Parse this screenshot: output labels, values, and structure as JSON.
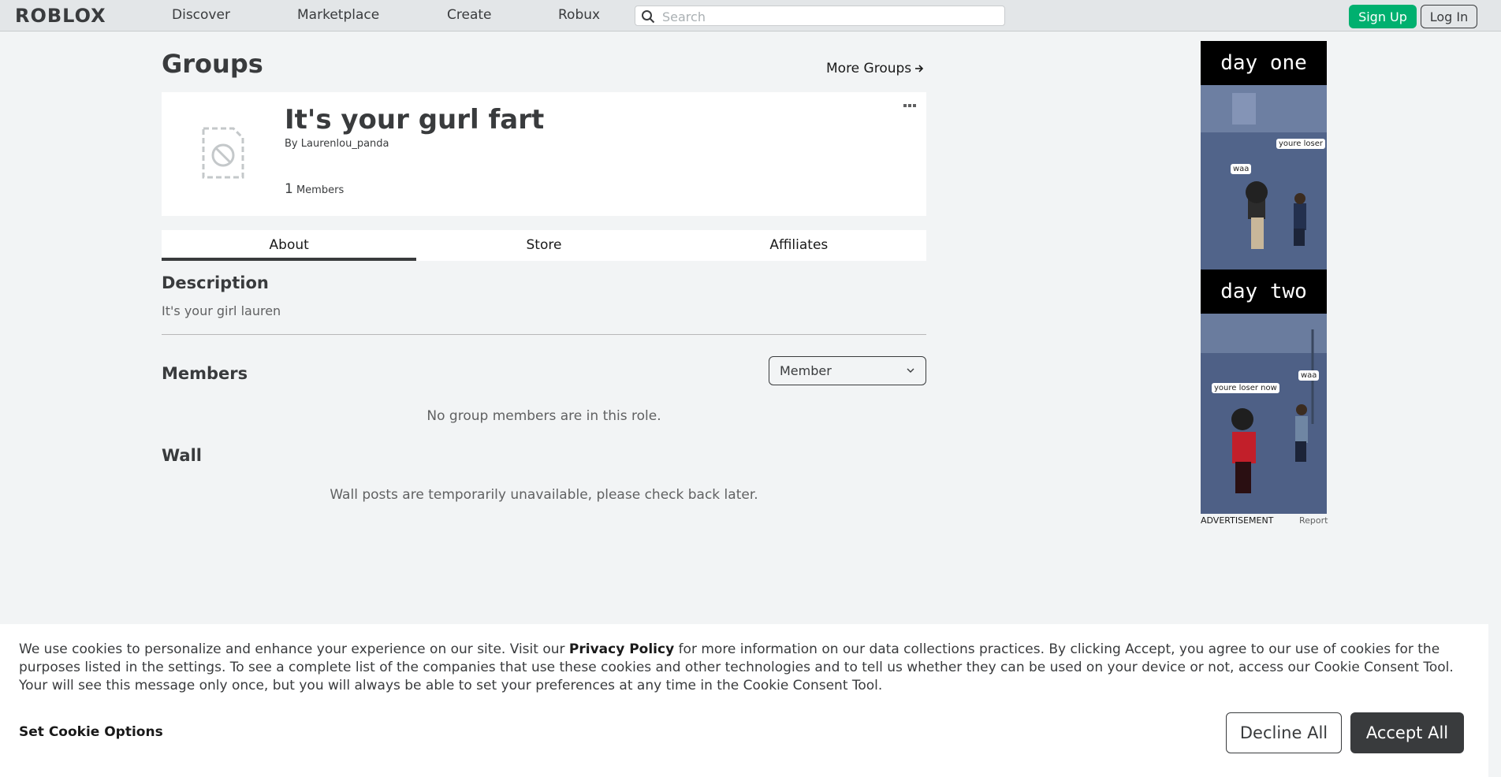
{
  "nav": {
    "logo": "ROBLOX",
    "links": [
      "Discover",
      "Marketplace",
      "Create",
      "Robux"
    ],
    "search_placeholder": "Search",
    "signup_label": "Sign Up",
    "login_label": "Log In"
  },
  "page": {
    "title": "Groups",
    "more_groups": "More Groups"
  },
  "group": {
    "name": "It's your gurl fart",
    "owner_prefix": "By",
    "owner_name": "Laurenlou_panda",
    "member_count": "1",
    "member_label": "Members"
  },
  "tabs": [
    {
      "label": "About",
      "active": true
    },
    {
      "label": "Store",
      "active": false
    },
    {
      "label": "Affiliates",
      "active": false
    }
  ],
  "description": {
    "title": "Description",
    "text": "It's your girl lauren"
  },
  "members": {
    "title": "Members",
    "role_selected": "Member",
    "empty_text": "No group members are in this role."
  },
  "wall": {
    "title": "Wall",
    "empty_text": "Wall posts are temporarily unavailable, please check back later."
  },
  "ad": {
    "panel1_title": "day one",
    "panel2_title": "day two",
    "bubble1": "youre loser",
    "bubble2": "waa",
    "bubble3": "youre loser now",
    "bubble4": "waa",
    "caption": "ADVERTISEMENT",
    "report": "Report"
  },
  "cookie": {
    "text_before": "We use cookies to personalize and enhance your experience on our site. Visit our ",
    "privacy_link": "Privacy Policy",
    "text_after": " for more information on our data collections practices. By clicking Accept, you agree to our use of cookies for the purposes listed in the settings. To see a complete list of the companies that use these cookies and other technologies and to tell us whether they can be used on your device or not, access our Cookie Consent Tool. Your will see this message only once, but you will always be able to set your preferences at any time in the Cookie Consent Tool.",
    "options_label": "Set Cookie Options",
    "decline_label": "Decline All",
    "accept_label": "Accept All"
  }
}
